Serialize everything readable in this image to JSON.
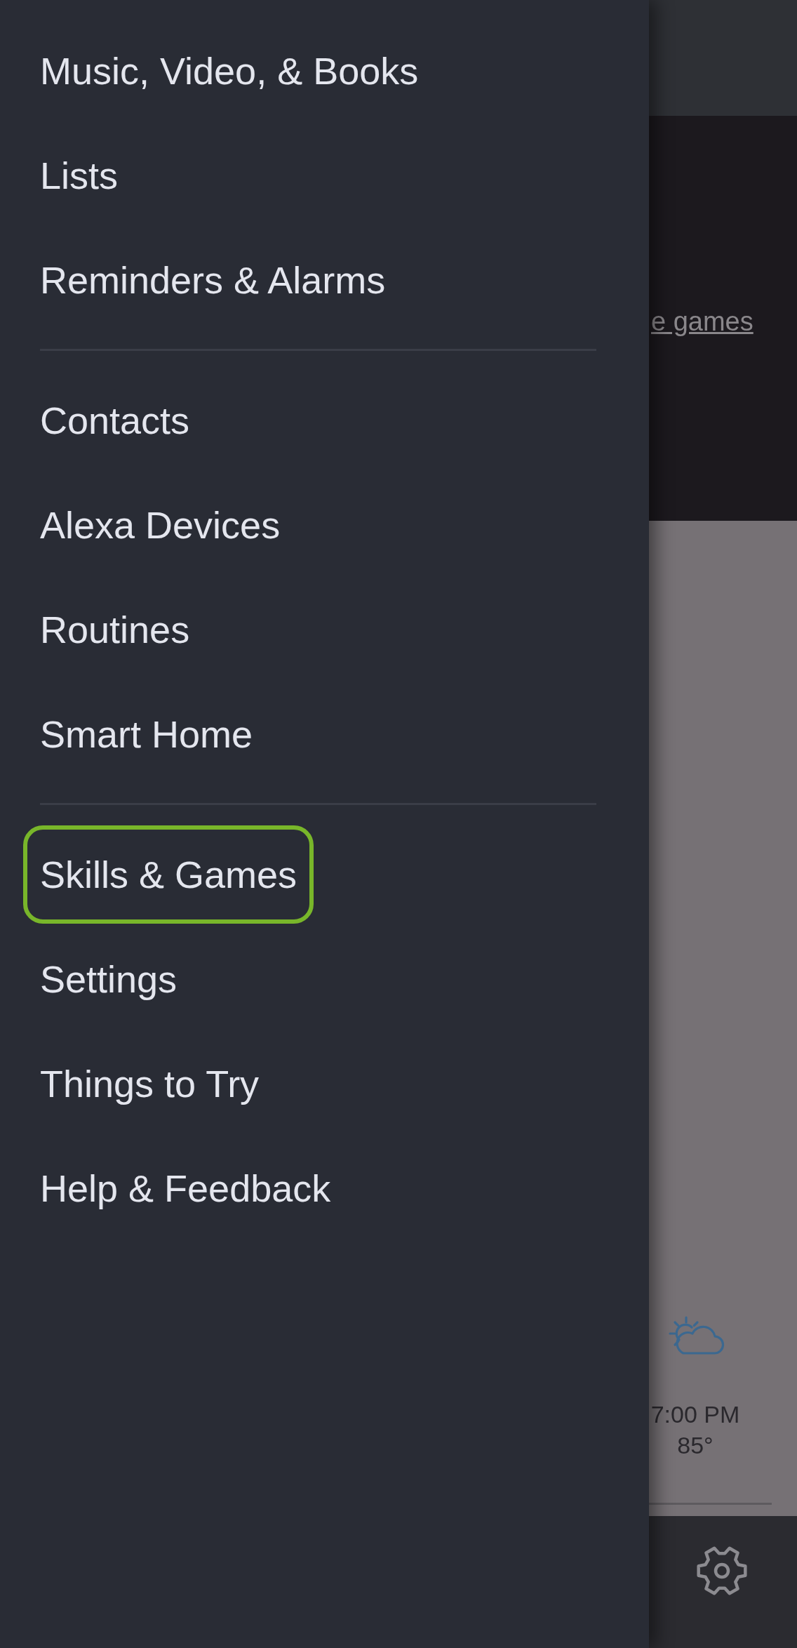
{
  "drawer": {
    "sections": [
      {
        "items": [
          {
            "label": "Music, Video, & Books",
            "highlighted": false
          },
          {
            "label": "Lists",
            "highlighted": false
          },
          {
            "label": "Reminders & Alarms",
            "highlighted": false
          }
        ]
      },
      {
        "items": [
          {
            "label": "Contacts",
            "highlighted": false
          },
          {
            "label": "Alexa Devices",
            "highlighted": false
          },
          {
            "label": "Routines",
            "highlighted": false
          },
          {
            "label": "Smart Home",
            "highlighted": false
          }
        ]
      },
      {
        "items": [
          {
            "label": "Skills & Games",
            "highlighted": true
          },
          {
            "label": "Settings",
            "highlighted": false
          },
          {
            "label": "Things to Try",
            "highlighted": false
          },
          {
            "label": "Help & Feedback",
            "highlighted": false
          }
        ]
      }
    ]
  },
  "background": {
    "link": {
      "text": "e games"
    },
    "forecast": {
      "time": "7:00 PM",
      "temperature": "85°"
    }
  }
}
